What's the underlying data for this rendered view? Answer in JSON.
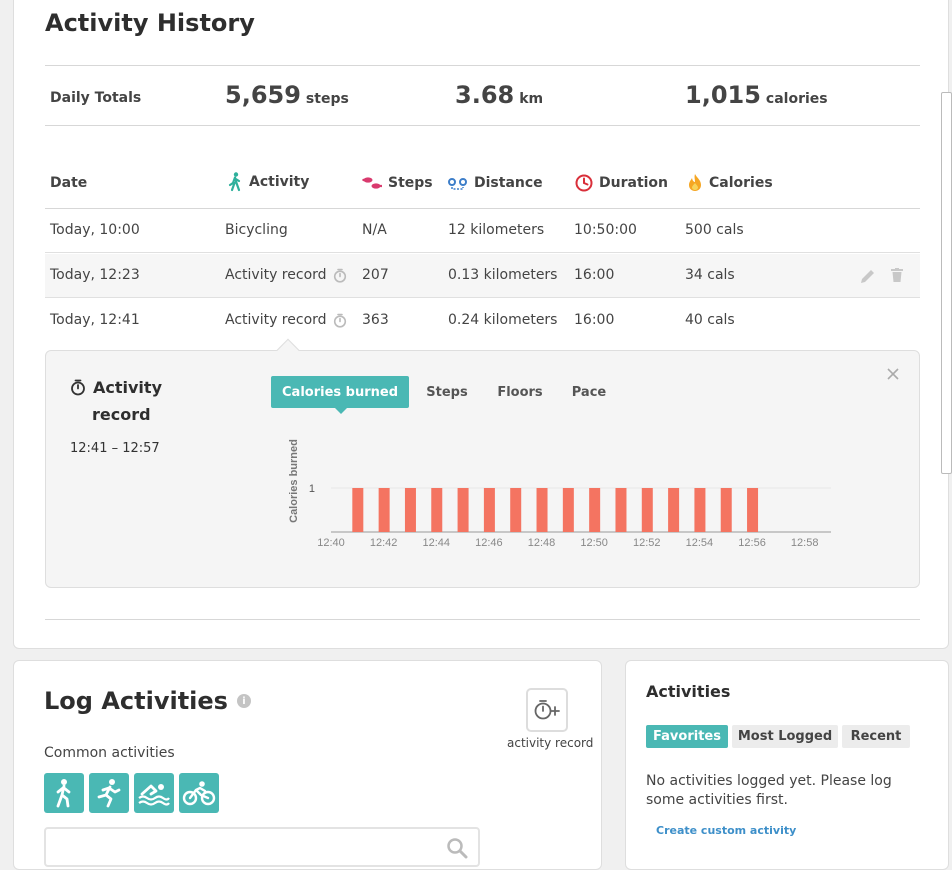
{
  "history": {
    "title": "Activity History",
    "totals": {
      "label": "Daily Totals",
      "steps": "5,659",
      "steps_unit": "steps",
      "distance": "3.68",
      "distance_unit": "km",
      "calories": "1,015",
      "calories_unit": "calories"
    },
    "columns": {
      "date": "Date",
      "activity": "Activity",
      "steps": "Steps",
      "distance": "Distance",
      "duration": "Duration",
      "calories": "Calories"
    },
    "rows": [
      {
        "date": "Today, 10:00",
        "activity": "Bicycling",
        "steps": "N/A",
        "distance": "12 kilometers",
        "duration": "10:50:00",
        "calories": "500 cals"
      },
      {
        "date": "Today, 12:23",
        "activity": "Activity record",
        "steps": "207",
        "distance": "0.13 kilometers",
        "duration": "16:00",
        "calories": "34 cals"
      },
      {
        "date": "Today, 12:41",
        "activity": "Activity record",
        "steps": "363",
        "distance": "0.24 kilometers",
        "duration": "16:00",
        "calories": "40 cals"
      }
    ]
  },
  "detail": {
    "title_line1": "Activity",
    "title_line2": "record",
    "time_range": "12:41 – 12:57",
    "tabs": [
      "Calories burned",
      "Steps",
      "Floors",
      "Pace"
    ],
    "active_tab": 0
  },
  "chart_data": {
    "type": "bar",
    "ylabel": "Calories burned",
    "y_ticks": [
      "1"
    ],
    "ylim": [
      0,
      1
    ],
    "x_ticks": [
      "12:40",
      "12:42",
      "12:44",
      "12:46",
      "12:48",
      "12:50",
      "12:52",
      "12:54",
      "12:56",
      "12:58"
    ],
    "x_minutes": [
      41,
      42,
      43,
      44,
      45,
      46,
      47,
      48,
      49,
      50,
      51,
      52,
      53,
      54,
      55,
      56
    ],
    "values": [
      1,
      1,
      1,
      1,
      1,
      1,
      1,
      1,
      1,
      1,
      1,
      1,
      1,
      1,
      1,
      1
    ],
    "bar_color": "#f47461"
  },
  "log": {
    "title": "Log Activities",
    "common_label": "Common activities",
    "record_button_label": "activity record"
  },
  "activities": {
    "title": "Activities",
    "tabs": [
      "Favorites",
      "Most Logged",
      "Recent"
    ],
    "empty_message_line1": "No activities logged yet. Please log",
    "empty_message_line2": "some activities first.",
    "create_link": "Create custom activity"
  },
  "colors": {
    "accent": "#4ab8b4",
    "bar": "#f47461",
    "link": "#3d8fc9"
  }
}
